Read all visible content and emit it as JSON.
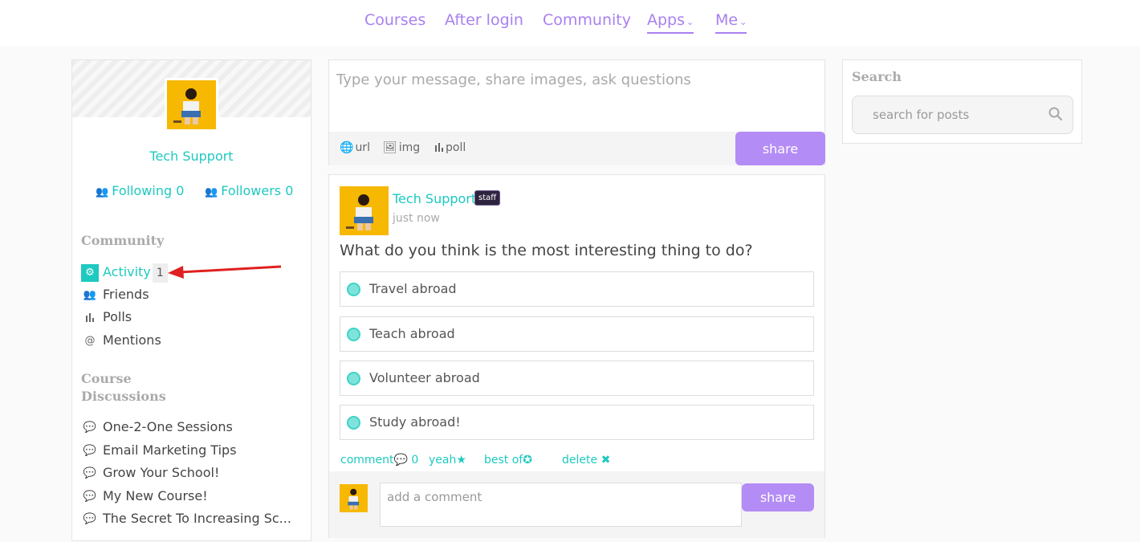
{
  "nav": {
    "items": [
      {
        "label": "Courses"
      },
      {
        "label": "After login"
      },
      {
        "label": "Community"
      },
      {
        "label": "Apps"
      },
      {
        "label": "Me"
      }
    ]
  },
  "profile": {
    "name": "Tech Support",
    "following_label": "Following",
    "following_count": "0",
    "followers_label": "Followers",
    "followers_count": "0"
  },
  "community": {
    "heading": "Community",
    "items": [
      {
        "label": "Activity",
        "badge": "1",
        "icon": "activity-icon"
      },
      {
        "label": "Friends",
        "icon": "friends-icon"
      },
      {
        "label": "Polls",
        "icon": "polls-icon"
      },
      {
        "label": "Mentions",
        "icon": "at-icon"
      }
    ]
  },
  "course_discussions": {
    "heading_line1": "Course",
    "heading_line2": "Discussions",
    "items": [
      {
        "label": "One-2-One Sessions"
      },
      {
        "label": "Email Marketing Tips"
      },
      {
        "label": "Grow Your School!"
      },
      {
        "label": "My New Course!"
      },
      {
        "label": "The Secret To Increasing Sc..."
      }
    ]
  },
  "composer": {
    "placeholder": "Type your message, share images, ask questions",
    "tools": [
      {
        "label": "url",
        "icon": "globe-icon"
      },
      {
        "label": "img",
        "icon": "image-icon"
      },
      {
        "label": "poll",
        "icon": "poll-icon"
      }
    ],
    "share_label": "share"
  },
  "post": {
    "author": "Tech Support",
    "badge": "staff",
    "time": "just now",
    "question": "What do you think is the most interesting thing to do?",
    "options": [
      {
        "label": "Travel abroad"
      },
      {
        "label": "Teach abroad"
      },
      {
        "label": "Volunteer abroad"
      },
      {
        "label": "Study abroad!"
      }
    ],
    "actions": {
      "comment_label": "comment",
      "comment_count": "0",
      "yeah_label": "yeah",
      "bestof_label": "best of",
      "delete_label": "delete"
    },
    "comment_placeholder": "add a comment",
    "comment_share_label": "share"
  },
  "search": {
    "heading": "Search",
    "placeholder": "search for posts"
  },
  "colors": {
    "accent": "#1ec9c0",
    "nav": "#a880f0",
    "button": "#b48cf5",
    "arrow": "#e02020"
  }
}
